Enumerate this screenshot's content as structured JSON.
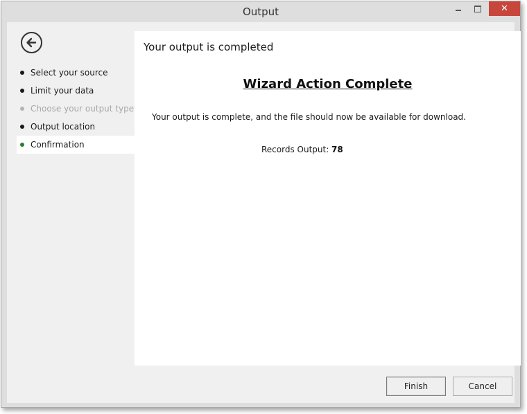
{
  "window": {
    "title": "Output",
    "close_glyph": "✕"
  },
  "icons": {
    "back": "back-arrow-icon",
    "minimize": "minimize-icon",
    "maximize": "maximize-icon",
    "close": "close-icon"
  },
  "sidebar": {
    "steps": [
      {
        "label": "Select your source",
        "state": "normal"
      },
      {
        "label": "Limit your data",
        "state": "normal"
      },
      {
        "label": "Choose your output type",
        "state": "disabled"
      },
      {
        "label": "Output location",
        "state": "normal"
      },
      {
        "label": "Confirmation",
        "state": "active"
      }
    ]
  },
  "content": {
    "heading": "Your output is completed",
    "wizard_title": "Wizard Action Complete",
    "message": "Your output is complete, and the file should now be available for download.",
    "records_label": "Records Output:",
    "records_value": "78"
  },
  "buttons": {
    "finish": "Finish",
    "cancel": "Cancel"
  },
  "colors": {
    "active_bullet": "#2e7d32",
    "close_button": "#c7473c",
    "disabled_text": "#a8a8a8"
  }
}
